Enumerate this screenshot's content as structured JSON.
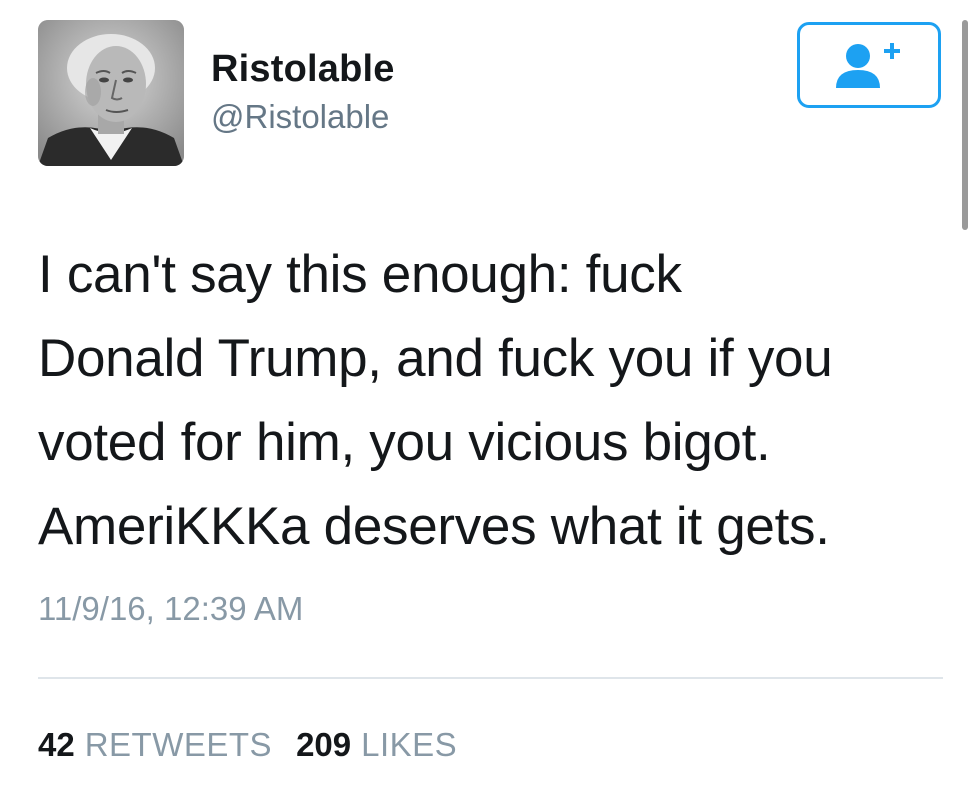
{
  "user": {
    "display_name": "Ristolable",
    "handle": "@Ristolable",
    "avatar_icon": "grayscale-portrait"
  },
  "follow_button": {
    "icon": "add-user-icon",
    "accent_color": "#1da1f2"
  },
  "tweet": {
    "text": "I can't say this enough: fuck\nDonald Trump, and fuck you if you\nvoted for him, you vicious bigot.\nAmeriKKKa deserves what it gets.",
    "timestamp": "11/9/16, 12:39 AM"
  },
  "stats": {
    "retweets_count": "42",
    "retweets_label": "RETWEETS",
    "likes_count": "209",
    "likes_label": "LIKES"
  }
}
